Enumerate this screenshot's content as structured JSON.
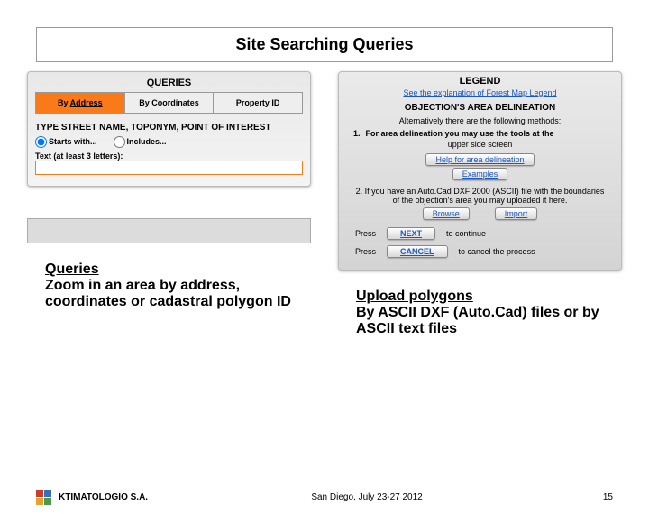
{
  "title": "Site Searching Queries",
  "left": {
    "panel_title": "QUERIES",
    "tabs": [
      "By Address",
      "By Coordinates",
      "Property ID"
    ],
    "instr": "TYPE STREET NAME, TOPONYM, POINT OF INTEREST",
    "radio1": "Starts with...",
    "radio2": "Includes...",
    "text_label": "Text (at least 3 letters):",
    "desc_underline": "Queries",
    "desc_rest": "Zoom in an area by address, coordinates or cadastral polygon ID"
  },
  "right": {
    "legend_title": "LEGEND",
    "legend_link": "See the explanation of Forest Map Legend",
    "obj_title": "OBJECTION'S AREA DELINEATION",
    "alt": "Alternatively there are the following methods:",
    "step1_num": "1.",
    "step1": "For area delineation you may use the tools at the",
    "step1_sub": "upper side screen",
    "help_btn": "Help for area delineation",
    "examples_btn": "Examples",
    "step2a": "2. If you have an Auto.Cad DXF 2000 (ASCII) file with the boundaries",
    "step2b": "of the objection's area you may uploaded it here.",
    "browse_btn": "Browse",
    "import_btn": "Import",
    "press": "Press",
    "next_btn": "NEXT",
    "next_txt": "to continue",
    "cancel_btn": "CANCEL",
    "cancel_txt": "to cancel the process",
    "desc_underline": "Upload polygons",
    "desc_rest": "By ASCII DXF (Auto.Cad) files or by ASCII text files"
  },
  "footer": {
    "org": "KTIMATOLOGIO S.A.",
    "venue": "San Diego, July 23-27 2012",
    "page": "15"
  }
}
